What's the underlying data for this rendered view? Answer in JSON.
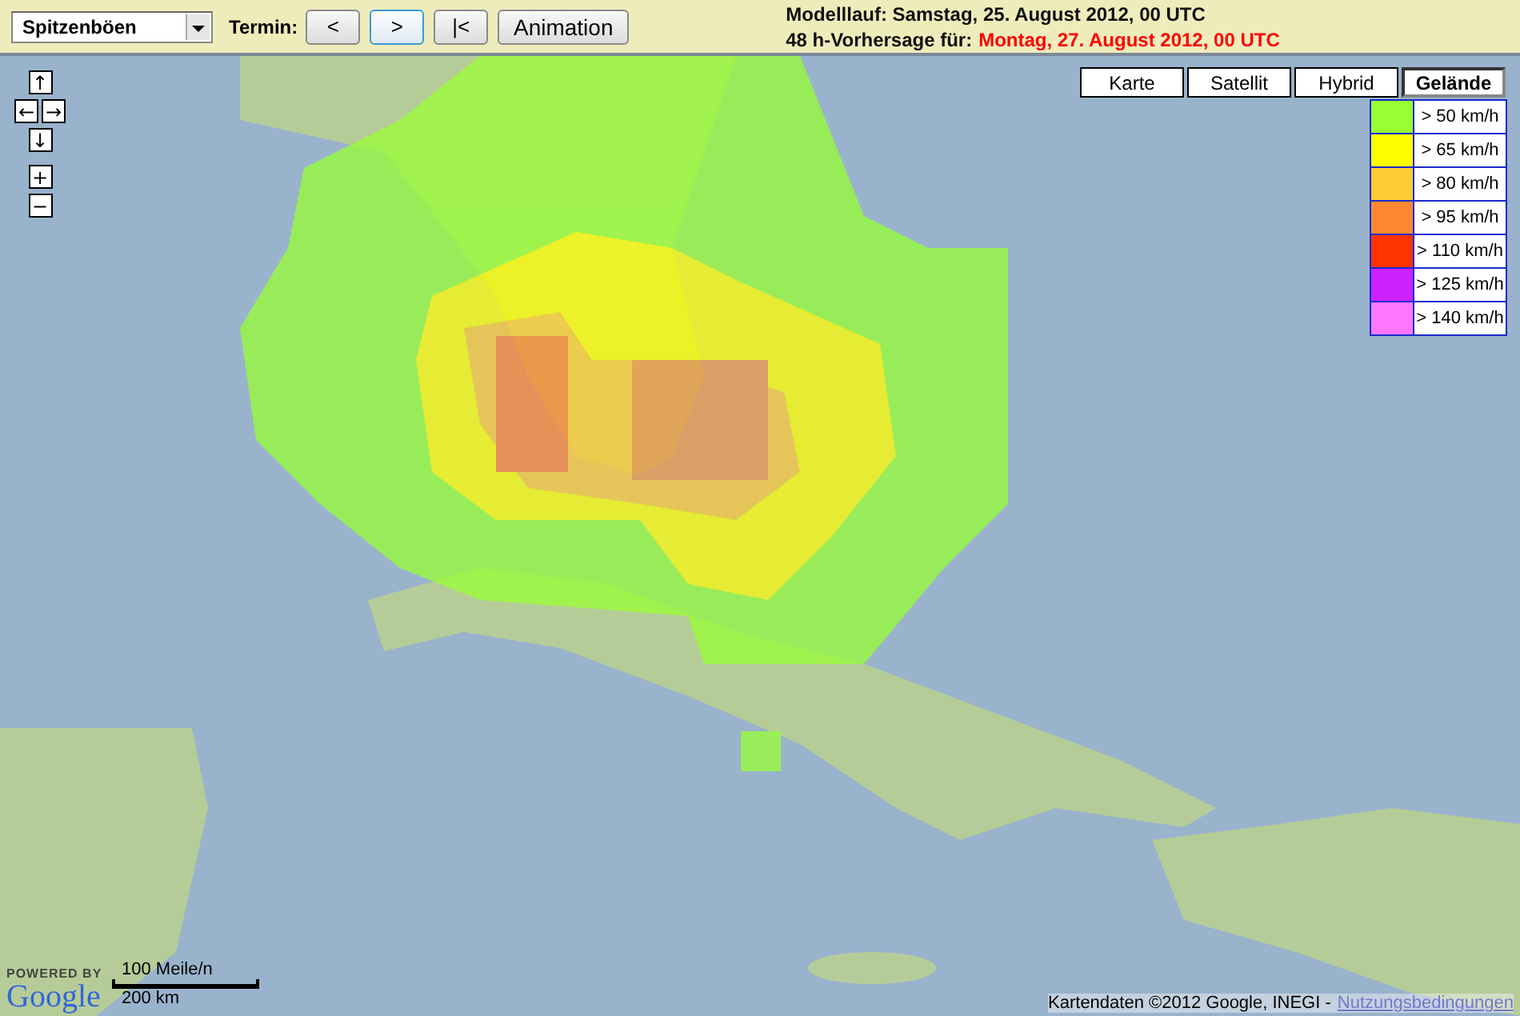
{
  "toolbar": {
    "parameter_select": {
      "value": "Spitzenböen"
    },
    "termin_label": "Termin:",
    "buttons": [
      {
        "label": "<",
        "selected": false
      },
      {
        "label": ">",
        "selected": true
      },
      {
        "label": "|<",
        "selected": false
      },
      {
        "label": "Animation",
        "selected": false
      }
    ]
  },
  "run_info": {
    "model_run": "Modelllauf: Samstag, 25. August 2012, 00 UTC",
    "forecast_label": "48 h-Vorhersage für:",
    "forecast_time": "Montag, 27. August 2012, 00 UTC"
  },
  "map": {
    "nav_controls": [
      "↑",
      "←",
      "→",
      "↓",
      "+",
      "−"
    ],
    "map_types": [
      {
        "label": "Karte",
        "selected": false
      },
      {
        "label": "Satellit",
        "selected": false
      },
      {
        "label": "Hybrid",
        "selected": false
      },
      {
        "label": "Gelände",
        "selected": true
      }
    ],
    "legend": [
      {
        "label": "> 50 km/h",
        "color": "#99ff33"
      },
      {
        "label": "> 65 km/h",
        "color": "#ffff00"
      },
      {
        "label": "> 80 km/h",
        "color": "#ffcc33"
      },
      {
        "label": "> 95 km/h",
        "color": "#ff8833"
      },
      {
        "label": "> 110 km/h",
        "color": "#ff3300"
      },
      {
        "label": "> 125 km/h",
        "color": "#cc22ff"
      },
      {
        "label": "> 140 km/h",
        "color": "#ff77ff"
      }
    ],
    "logo": {
      "caption": "POWERED BY",
      "name": "Google"
    },
    "scale": [
      "100 Meile/n",
      "200 km"
    ],
    "attribution": {
      "text": "Kartendaten ©2012 Google, INEGI -",
      "link": "Nutzungsbedingungen"
    }
  }
}
